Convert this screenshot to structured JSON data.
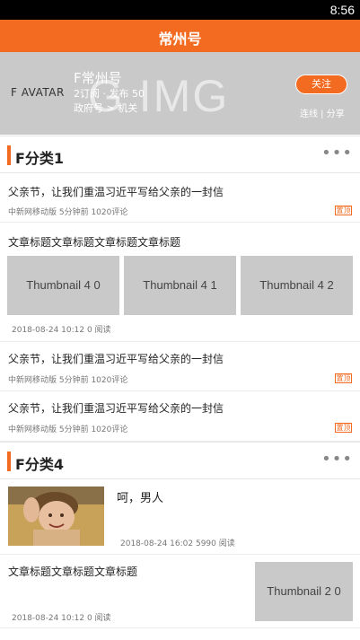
{
  "status_bar": {
    "time": "8:56"
  },
  "header": {
    "title": "常州号"
  },
  "banner": {
    "bg_text": "G IMG",
    "avatar": "F AVATAR",
    "name": "F常州号",
    "stats": "2订阅 · 发布 50",
    "category": "政府号 > 机关",
    "follow_label": "关注",
    "links": "连线 | 分享"
  },
  "sections": [
    {
      "title": "F分类1",
      "more": "•••",
      "articles": [
        {
          "title": "父亲节，让我们重温习近平写给父亲的一封信",
          "meta": "中新网移动版  5分钟前  1020评论",
          "badge": "置顶"
        },
        {
          "title": "文章标题文章标题文章标题文章标题",
          "thumbs": [
            "Thumbnail 4 0",
            "Thumbnail 4 1",
            "Thumbnail 4 2"
          ],
          "meta": "2018-08-24 10:12  0 阅读"
        },
        {
          "title": "父亲节，让我们重温习近平写给父亲的一封信",
          "meta": "中新网移动版  5分钟前  1020评论",
          "badge": "置顶"
        },
        {
          "title": "父亲节，让我们重温习近平写给父亲的一封信",
          "meta": "中新网移动版  5分钟前  1020评论",
          "badge": "置顶"
        }
      ]
    },
    {
      "title": "F分类4",
      "more": "•••",
      "articles": [
        {
          "title": "呵，男人",
          "meta": "2018-08-24 16:02  5990 阅读"
        },
        {
          "title": "文章标题文章标题文章标题",
          "thumb": "Thumbnail 2 0",
          "meta": "2018-08-24 10:12  0 阅读"
        }
      ]
    }
  ]
}
